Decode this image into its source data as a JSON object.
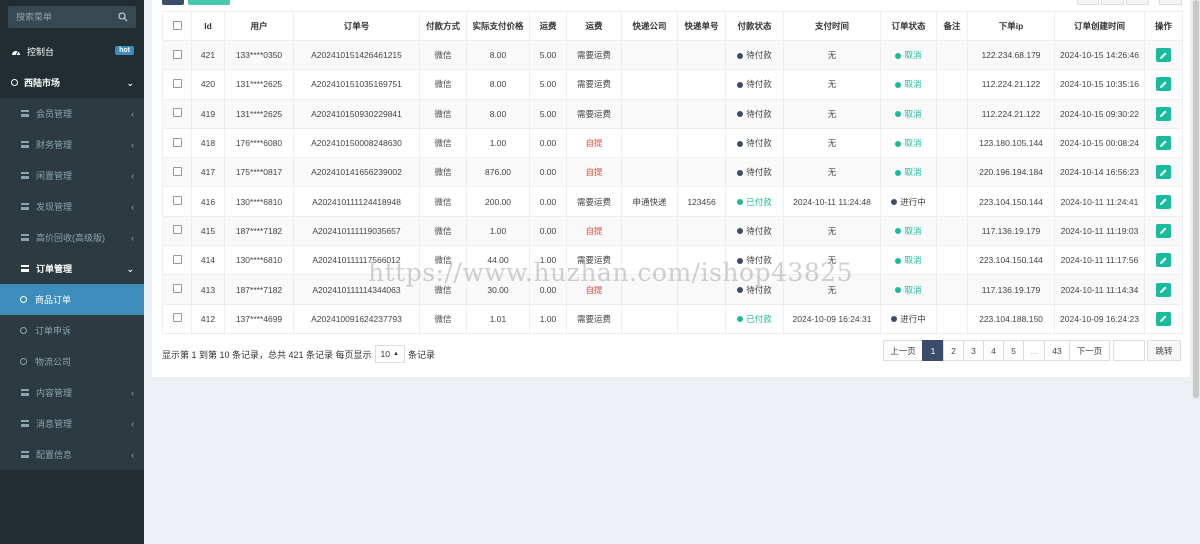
{
  "sidebar": {
    "search_placeholder": "搜索菜单",
    "items": [
      {
        "label": "控制台",
        "badge": "hot",
        "icon": "dashboard-icon"
      },
      {
        "label": "西陆市场",
        "icon": "circle-icon"
      },
      {
        "label": "会员管理",
        "icon": "list-icon"
      },
      {
        "label": "财务管理",
        "icon": "list-icon"
      },
      {
        "label": "闲置管理",
        "icon": "list-icon"
      },
      {
        "label": "发现管理",
        "icon": "list-icon"
      },
      {
        "label": "高价回收(高级版)",
        "icon": "list-icon"
      },
      {
        "label": "订单管理",
        "icon": "list-icon"
      },
      {
        "label": "内容管理",
        "icon": "list-icon"
      },
      {
        "label": "消息管理",
        "icon": "list-icon"
      },
      {
        "label": "配置信息",
        "icon": "list-icon"
      }
    ],
    "order_sub": [
      {
        "label": "商品订单"
      },
      {
        "label": "订单申诉"
      },
      {
        "label": "物流公司"
      }
    ]
  },
  "table": {
    "headers": [
      "Id",
      "用户",
      "订单号",
      "付款方式",
      "实际支付价格",
      "运费",
      "运费",
      "快递公司",
      "快递单号",
      "付款状态",
      "支付时间",
      "订单状态",
      "备注",
      "下单ip",
      "订单创建时间",
      "操作"
    ],
    "rows": [
      {
        "id": "421",
        "user": "133****0350",
        "order_no": "A202410151426461215",
        "pay_method": "微信",
        "price": "8.00",
        "freight": "5.00",
        "freight_type": "需要运费",
        "express": "",
        "express_no": "",
        "pay_status": "待付款",
        "pay_time": "无",
        "order_status": "取消",
        "remark": "",
        "ip": "122.234.68.179",
        "created": "2024-10-15 14:26:46"
      },
      {
        "id": "420",
        "user": "131****2625",
        "order_no": "A202410151035169751",
        "pay_method": "微信",
        "price": "8.00",
        "freight": "5.00",
        "freight_type": "需要运费",
        "express": "",
        "express_no": "",
        "pay_status": "待付款",
        "pay_time": "无",
        "order_status": "取消",
        "remark": "",
        "ip": "112.224.21.122",
        "created": "2024-10-15 10:35:16"
      },
      {
        "id": "419",
        "user": "131****2625",
        "order_no": "A202410150930229841",
        "pay_method": "微信",
        "price": "8.00",
        "freight": "5.00",
        "freight_type": "需要运费",
        "express": "",
        "express_no": "",
        "pay_status": "待付款",
        "pay_time": "无",
        "order_status": "取消",
        "remark": "",
        "ip": "112.224.21.122",
        "created": "2024-10-15 09:30:22"
      },
      {
        "id": "418",
        "user": "176****6080",
        "order_no": "A202410150008248630",
        "pay_method": "微信",
        "price": "1.00",
        "freight": "0.00",
        "freight_type": "自提",
        "express": "",
        "express_no": "",
        "pay_status": "待付款",
        "pay_time": "无",
        "order_status": "取消",
        "remark": "",
        "ip": "123.180.105.144",
        "created": "2024-10-15 00:08:24"
      },
      {
        "id": "417",
        "user": "175****0817",
        "order_no": "A202410141656239002",
        "pay_method": "微信",
        "price": "876.00",
        "freight": "0.00",
        "freight_type": "自提",
        "express": "",
        "express_no": "",
        "pay_status": "待付款",
        "pay_time": "无",
        "order_status": "取消",
        "remark": "",
        "ip": "220.196.194.184",
        "created": "2024-10-14 16:56:23"
      },
      {
        "id": "416",
        "user": "130****6810",
        "order_no": "A202410111124418948",
        "pay_method": "微信",
        "price": "200.00",
        "freight": "0.00",
        "freight_type": "需要运费",
        "express": "申通快递",
        "express_no": "123456",
        "pay_status": "已付款",
        "pay_time": "2024-10-11 11:24:48",
        "order_status": "进行中",
        "remark": "",
        "ip": "223.104.150.144",
        "created": "2024-10-11 11:24:41"
      },
      {
        "id": "415",
        "user": "187****7182",
        "order_no": "A202410111119035657",
        "pay_method": "微信",
        "price": "1.00",
        "freight": "0.00",
        "freight_type": "自提",
        "express": "",
        "express_no": "",
        "pay_status": "待付款",
        "pay_time": "无",
        "order_status": "取消",
        "remark": "",
        "ip": "117.136.19.179",
        "created": "2024-10-11 11:19:03"
      },
      {
        "id": "414",
        "user": "130****6810",
        "order_no": "A202410111117566012",
        "pay_method": "微信",
        "price": "44.00",
        "freight": "1.00",
        "freight_type": "需要运费",
        "express": "",
        "express_no": "",
        "pay_status": "待付款",
        "pay_time": "无",
        "order_status": "取消",
        "remark": "",
        "ip": "223.104.150.144",
        "created": "2024-10-11 11:17:56"
      },
      {
        "id": "413",
        "user": "187****7182",
        "order_no": "A202410111114344063",
        "pay_method": "微信",
        "price": "30.00",
        "freight": "0.00",
        "freight_type": "自提",
        "express": "",
        "express_no": "",
        "pay_status": "待付款",
        "pay_time": "无",
        "order_status": "取消",
        "remark": "",
        "ip": "117.136.19.179",
        "created": "2024-10-11 11:14:34"
      },
      {
        "id": "412",
        "user": "137****4699",
        "order_no": "A202410091624237793",
        "pay_method": "微信",
        "price": "1.01",
        "freight": "1.00",
        "freight_type": "需要运费",
        "express": "",
        "express_no": "",
        "pay_status": "已付款",
        "pay_time": "2024-10-09 16:24:31",
        "order_status": "进行中",
        "remark": "",
        "ip": "223.104.188.150",
        "created": "2024-10-09 16:24:23"
      }
    ]
  },
  "footer": {
    "summary_prefix": "显示第 1 到第 10 条记录，总共 421 条记录 每页显示",
    "page_size": "10",
    "summary_suffix": "条记录"
  },
  "pagination": {
    "prev": "上一页",
    "pages": [
      "1",
      "2",
      "3",
      "4",
      "5",
      "...",
      "43"
    ],
    "next": "下一页",
    "jump": "跳转"
  },
  "watermark": "https://www.huzhan.com/ishop43825",
  "colors": {
    "sidebar_bg": "#222d32",
    "active_blue": "#3c8dbc",
    "green": "#18bc9c",
    "red": "#e74c3c",
    "pager_active": "#3c4d6c"
  }
}
